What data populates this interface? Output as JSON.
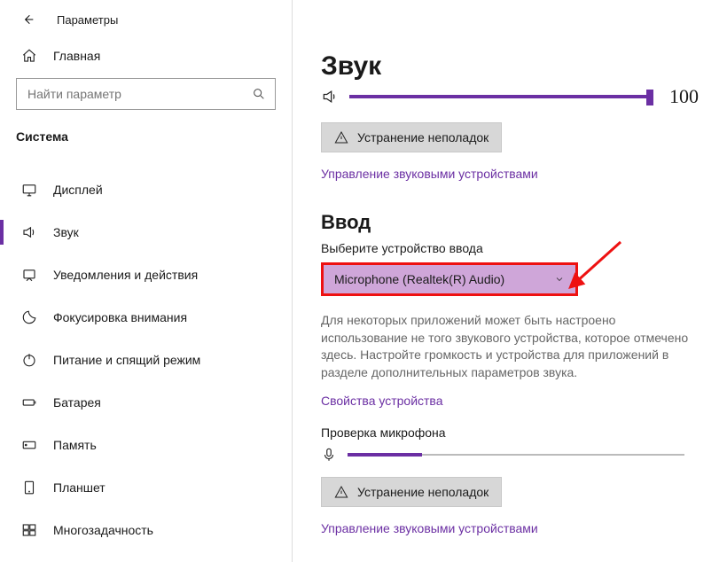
{
  "titlebar": {
    "title": "Параметры"
  },
  "sidebar": {
    "home": "Главная",
    "search_placeholder": "Найти параметр",
    "section": "Система",
    "items": [
      {
        "label": "Дисплей"
      },
      {
        "label": "Звук"
      },
      {
        "label": "Уведомления и действия"
      },
      {
        "label": "Фокусировка внимания"
      },
      {
        "label": "Питание и спящий режим"
      },
      {
        "label": "Батарея"
      },
      {
        "label": "Память"
      },
      {
        "label": "Планшет"
      },
      {
        "label": "Многозадачность"
      }
    ]
  },
  "main": {
    "title": "Звук",
    "volume": "100",
    "troubleshoot": "Устранение неполадок",
    "manage_devices": "Управление звуковыми устройствами",
    "input_heading": "Ввод",
    "select_label": "Выберите устройство ввода",
    "select_value": "Microphone (Realtek(R) Audio)",
    "desc": "Для некоторых приложений может быть настроено использование не того звукового устройства, которое отмечено здесь. Настройте громкость и устройства для приложений в разделе дополнительных параметров звука.",
    "device_props": "Свойства устройства",
    "mic_test": "Проверка микрофона",
    "mic_fill_percent": 22,
    "troubleshoot2": "Устранение неполадок",
    "manage_devices2": "Управление звуковыми устройствами"
  }
}
